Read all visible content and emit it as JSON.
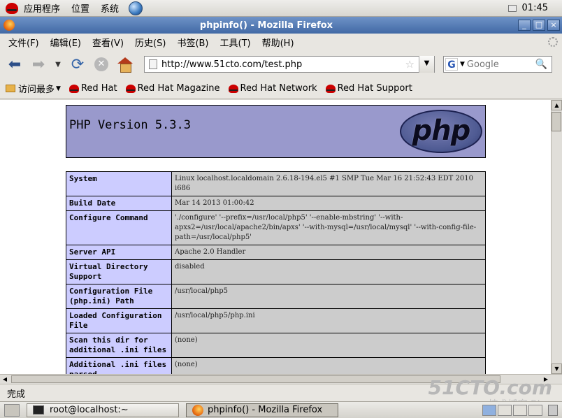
{
  "top_panel": {
    "menus": [
      "应用程序",
      "位置",
      "系统"
    ],
    "clock": "01:45"
  },
  "window": {
    "title": "phpinfo() - Mozilla Firefox",
    "minimize": "_",
    "maximize": "□",
    "close": "×"
  },
  "menubar": [
    "文件(F)",
    "编辑(E)",
    "查看(V)",
    "历史(S)",
    "书签(B)",
    "工具(T)",
    "帮助(H)"
  ],
  "nav": {
    "url": "http://www.51cto.com/test.php",
    "search_placeholder": "Google",
    "search_engine_letter": "G"
  },
  "bookmarks": {
    "most_visited": "访问最多",
    "items": [
      "Red Hat",
      "Red Hat Magazine",
      "Red Hat Network",
      "Red Hat Support"
    ]
  },
  "php": {
    "title": "PHP Version 5.3.3",
    "logo_text": "php",
    "rows": [
      {
        "key": "System",
        "value": "Linux localhost.localdomain 2.6.18-194.el5 #1 SMP Tue Mar 16 21:52:43 EDT 2010 i686"
      },
      {
        "key": "Build Date",
        "value": "Mar 14 2013 01:00:42"
      },
      {
        "key": "Configure Command",
        "value": "'./configure' '--prefix=/usr/local/php5' '--enable-mbstring' '--with-apxs2=/usr/local/apache2/bin/apxs' '--with-mysql=/usr/local/mysql' '--with-config-file-path=/usr/local/php5'"
      },
      {
        "key": "Server API",
        "value": "Apache 2.0 Handler"
      },
      {
        "key": "Virtual Directory Support",
        "value": "disabled"
      },
      {
        "key": "Configuration File (php.ini) Path",
        "value": "/usr/local/php5"
      },
      {
        "key": "Loaded Configuration File",
        "value": "/usr/local/php5/php.ini"
      },
      {
        "key": "Scan this dir for additional .ini files",
        "value": "(none)"
      },
      {
        "key": "Additional .ini files parsed",
        "value": "(none)"
      }
    ]
  },
  "status": {
    "text": "完成",
    "watermark": "51CTO.com",
    "watermark_sub": "技术博客 Blog"
  },
  "taskbar": {
    "tasks": [
      "root@localhost:~",
      "phpinfo() - Mozilla Firefox"
    ]
  }
}
